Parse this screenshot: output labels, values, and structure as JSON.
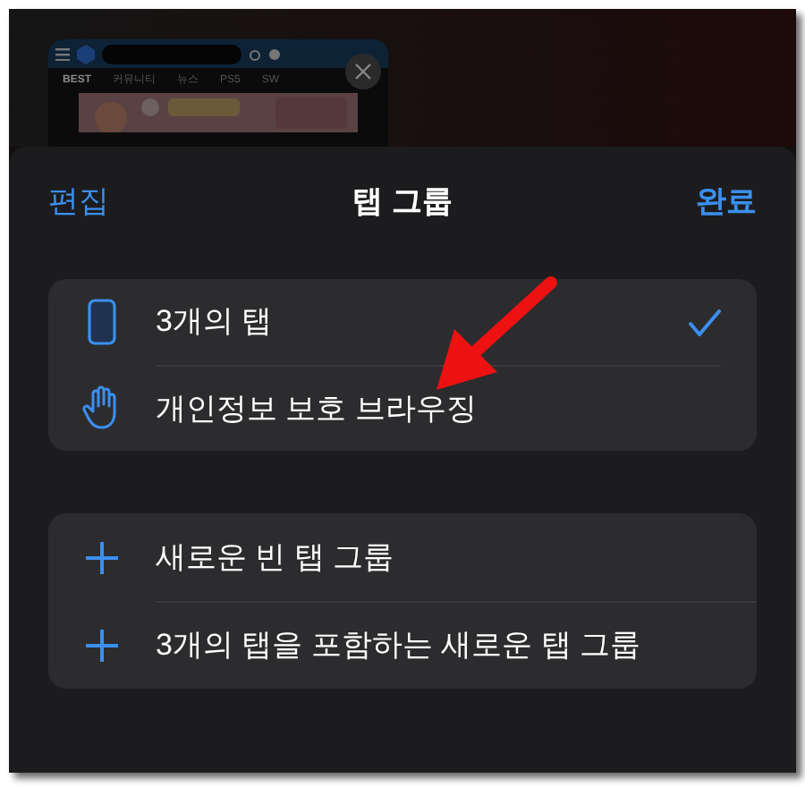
{
  "thumbnail": {
    "tabs": [
      {
        "label": "BEST",
        "selected": true
      },
      {
        "label": "커뮤니티",
        "selected": false
      },
      {
        "label": "뉴스",
        "selected": false
      },
      {
        "label": "PS5",
        "selected": false
      },
      {
        "label": "SW",
        "selected": false
      }
    ]
  },
  "sheet": {
    "left_button": "편집",
    "title": "탭 그룹",
    "right_button": "완료"
  },
  "groups": [
    {
      "kind": "phone",
      "selected": true,
      "label": "3개의 탭"
    },
    {
      "kind": "hand",
      "selected": false,
      "label": "개인정보 보호 브라우징"
    }
  ],
  "actions": [
    {
      "label": "새로운 빈 탭 그룹"
    },
    {
      "label": "3개의 탭을 포함하는 새로운 탭 그룹"
    }
  ]
}
